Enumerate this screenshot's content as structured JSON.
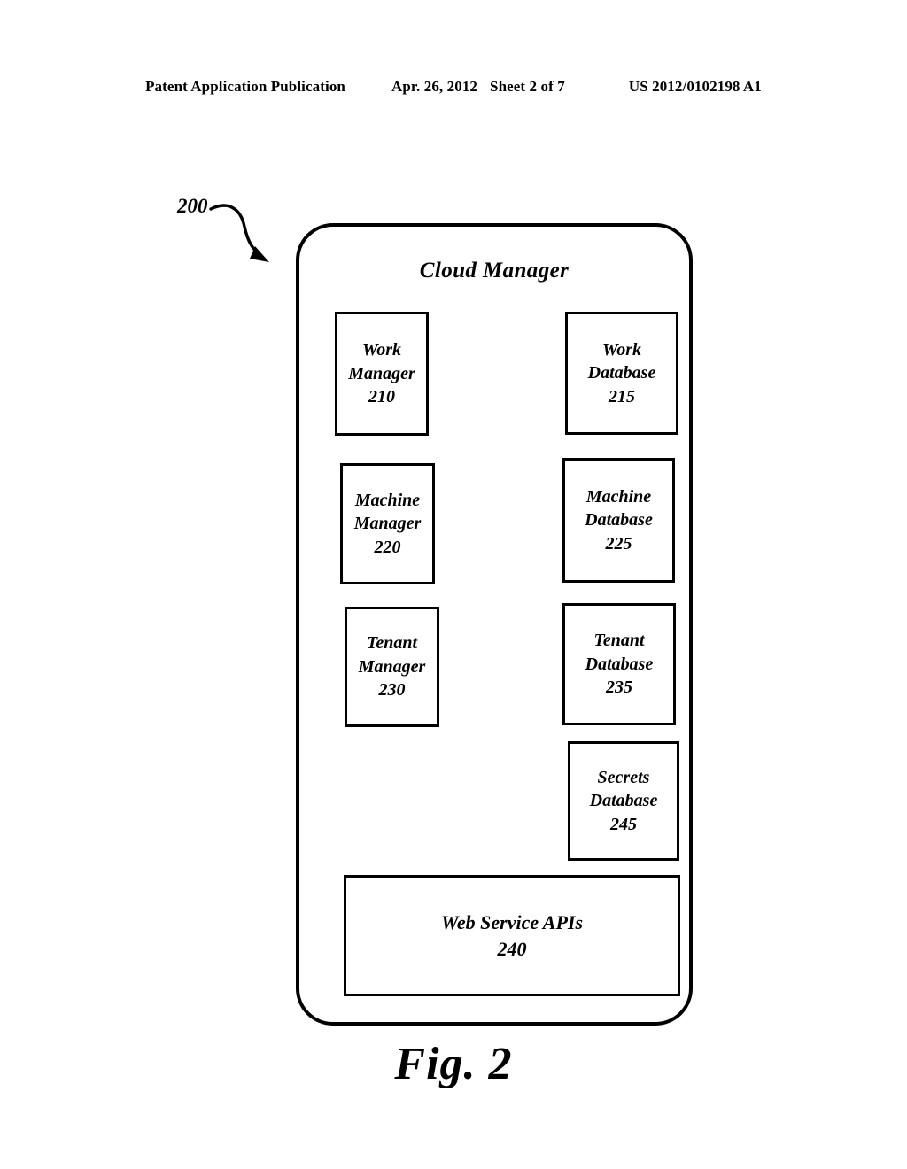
{
  "header": {
    "publication": "Patent Application Publication",
    "date": "Apr. 26, 2012",
    "sheet": "Sheet 2 of 7",
    "patent_number": "US 2012/0102198 A1"
  },
  "figure": {
    "reference_numeral": "200",
    "caption": "Fig. 2",
    "container": {
      "title": "Cloud Manager"
    },
    "boxes": [
      {
        "label": "Work\nManager",
        "number": "210"
      },
      {
        "label": "Work\nDatabase",
        "number": "215"
      },
      {
        "label": "Machine\nManager",
        "number": "220"
      },
      {
        "label": "Machine\nDatabase",
        "number": "225"
      },
      {
        "label": "Tenant\nManager",
        "number": "230"
      },
      {
        "label": "Tenant\nDatabase",
        "number": "235"
      },
      {
        "label": "Secrets\nDatabase",
        "number": "245"
      },
      {
        "label": "Web Service APIs",
        "number": "240"
      }
    ]
  },
  "colors": {
    "ink": "#000000",
    "paper": "#ffffff"
  }
}
